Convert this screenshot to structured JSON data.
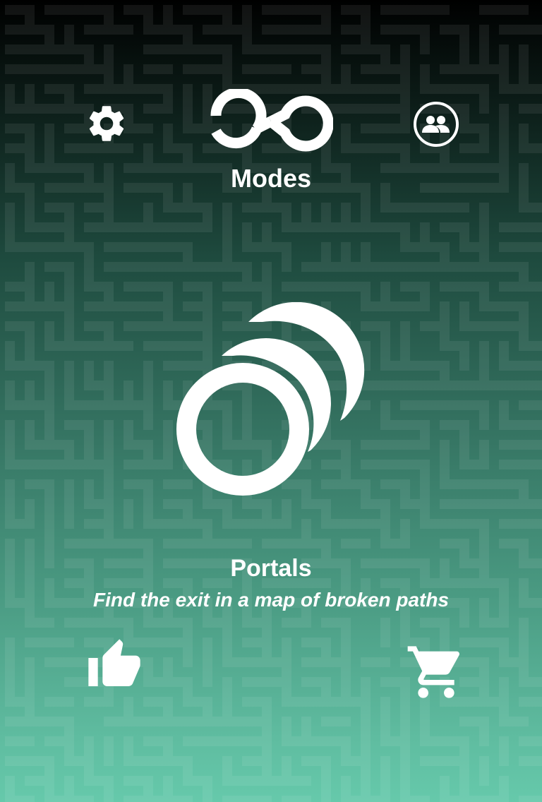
{
  "header": {
    "title": "Modes",
    "settings_icon": "gear-icon",
    "logo_icon": "infinity-icon",
    "social_icon": "friends-icon"
  },
  "mode": {
    "name": "Portals",
    "description": "Find the exit in a map of broken paths",
    "icon": "portals-icon"
  },
  "footer": {
    "like_icon": "thumbs-up-icon",
    "shop_icon": "shopping-cart-icon"
  },
  "colors": {
    "background_top": "#000000",
    "background_bottom": "#66c9ab",
    "foreground": "#ffffff"
  }
}
